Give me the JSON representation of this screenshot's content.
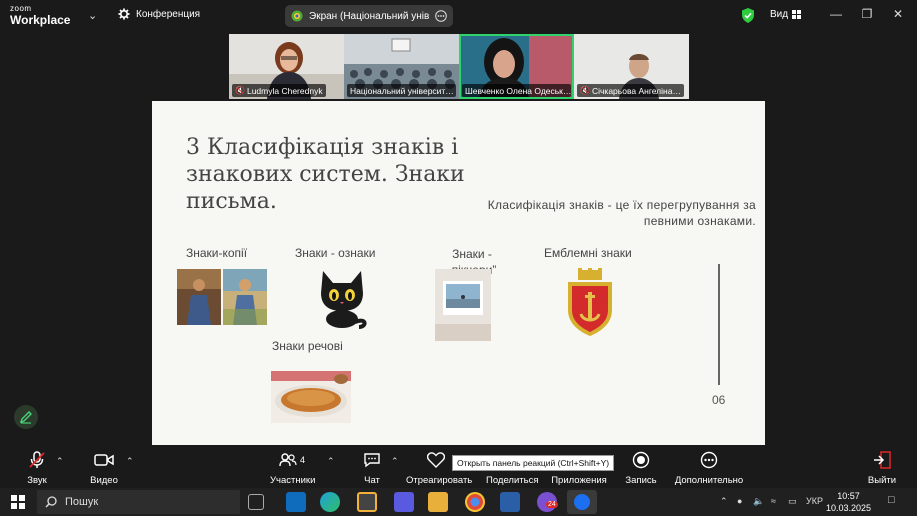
{
  "app": {
    "logo_line1": "zoom",
    "logo_line2": "Workplace"
  },
  "titlebar": {
    "conference": "Конференция",
    "screen_share": "Экран (Національний університ",
    "view": "Вид"
  },
  "participants": [
    {
      "name": "Ludmyla Cherednyk",
      "muted": true
    },
    {
      "name": "Національний університ…",
      "muted": false
    },
    {
      "name": "Шевченко Олена Одеськ…",
      "muted": false
    },
    {
      "name": "Січкарьова Ангеліна…",
      "muted": true
    }
  ],
  "slide": {
    "title": "3 Класифікація знаків і знакових систем. Знаки письма.",
    "subtitle": "Класифікація знаків - це їх перегрупування за певними ознаками.",
    "categories": {
      "copies": "Знаки-копії",
      "signs": "Знаки - ознаки",
      "cave": "Знаки - „пікчери”",
      "emblem": "Емблемні знаки",
      "material": "Знаки речові"
    },
    "page_number": "06"
  },
  "toolbar": {
    "audio": "Звук",
    "video": "Видео",
    "participants": "Участники",
    "participants_count": "4",
    "chat": "Чат",
    "react": "Отреагировать",
    "share": "Поделиться",
    "apps": "Приложения",
    "record": "Запись",
    "more": "Дополнительно",
    "leave": "Выйти",
    "tooltip": "Открыть панель реакций (Ctrl+Shift+Y)"
  },
  "taskbar": {
    "search": "Пошук",
    "lang": "УКР",
    "time": "10:57",
    "date": "10.03.2025",
    "badge": "24"
  },
  "colors": {
    "active_speaker": "#2fd36b",
    "leave": "#e02828",
    "slide_bg": "#f7f8f3"
  }
}
